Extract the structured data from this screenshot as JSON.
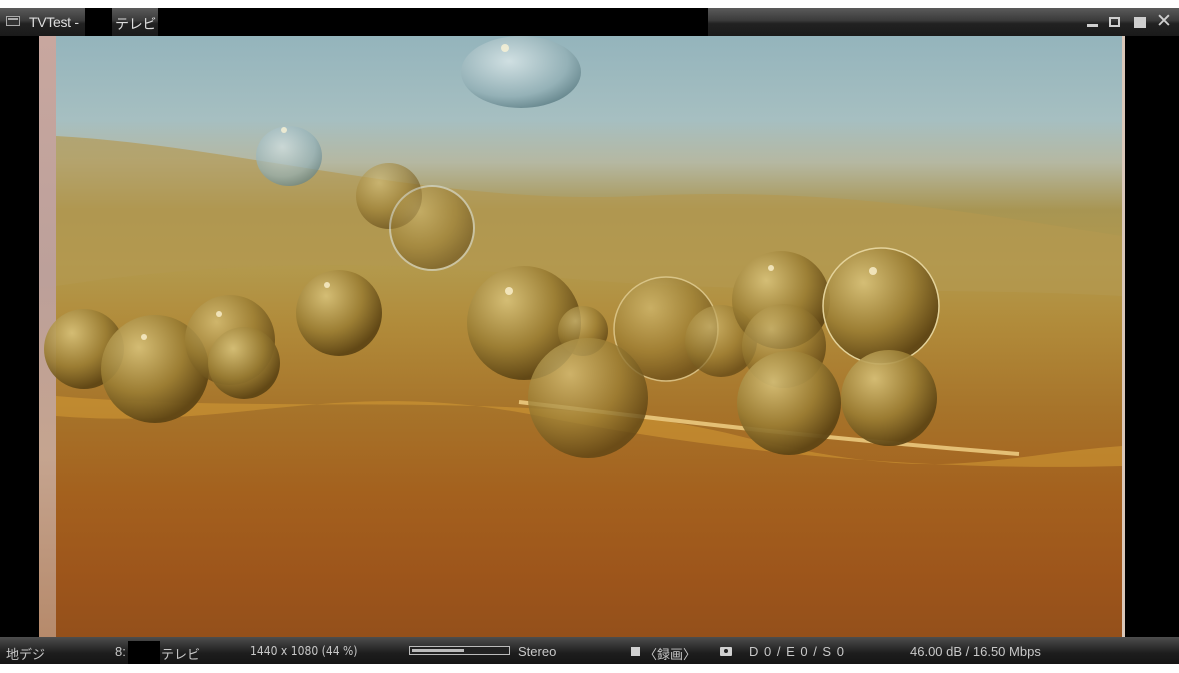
{
  "window": {
    "title_prefix": "TVTest -",
    "title_channel": "テレビ /",
    "buttons": [
      "minimize",
      "restore",
      "maximize",
      "close"
    ],
    "close_glyph": "✕"
  },
  "status_bar": {
    "network": "地デジ",
    "channel_number": "8:",
    "channel_name": "テレビ",
    "resolution": "1440 x 1080 (44 %)",
    "volume_level": 0.55,
    "audio": "Stereo",
    "record": "〈録画〉",
    "errors": "D 0 / E 0 / S 0",
    "signal": "46.00 dB / 16.50 Mbps"
  },
  "icons": {
    "app": "tv-window-icon",
    "record": "record-square-icon",
    "capture": "camera-icon"
  }
}
